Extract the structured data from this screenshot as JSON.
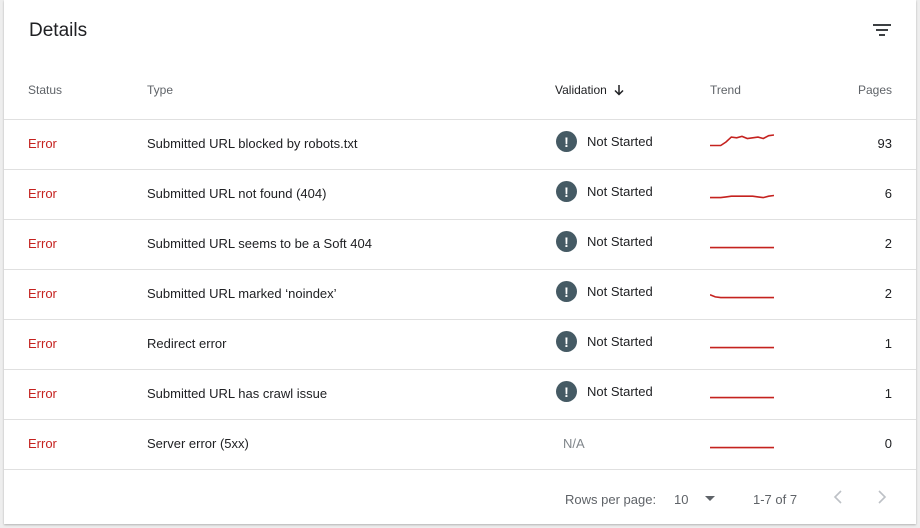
{
  "card": {
    "title": "Details",
    "filter_icon": "filter-list-icon"
  },
  "columns": {
    "status": "Status",
    "type": "Type",
    "validation": "Validation",
    "trend": "Trend",
    "pages": "Pages"
  },
  "rows": [
    {
      "status": "Error",
      "type": "Submitted URL blocked by robots.txt",
      "validation": "Not Started",
      "validation_icon": "!",
      "pages": "93",
      "trend": [
        0.25,
        0.25,
        0.25,
        0.5,
        0.85,
        0.8,
        0.9,
        0.75,
        0.8,
        0.85,
        0.75,
        0.95,
        1.0
      ]
    },
    {
      "status": "Error",
      "type": "Submitted URL not found (404)",
      "validation": "Not Started",
      "validation_icon": "!",
      "pages": "6",
      "trend": [
        0.1,
        0.1,
        0.1,
        0.15,
        0.2,
        0.2,
        0.2,
        0.2,
        0.2,
        0.15,
        0.1,
        0.2,
        0.25
      ]
    },
    {
      "status": "Error",
      "type": "Submitted URL seems to be a Soft 404",
      "validation": "Not Started",
      "validation_icon": "!",
      "pages": "2",
      "trend": [
        0.1,
        0.1,
        0.1,
        0.1,
        0.1,
        0.1,
        0.1,
        0.1,
        0.1,
        0.1,
        0.1,
        0.1,
        0.1
      ]
    },
    {
      "status": "Error",
      "type": "Submitted URL marked ‘noindex’",
      "validation": "Not Started",
      "validation_icon": "!",
      "pages": "2",
      "trend": [
        0.3,
        0.15,
        0.1,
        0.1,
        0.1,
        0.1,
        0.1,
        0.1,
        0.1,
        0.1,
        0.1,
        0.1,
        0.1
      ]
    },
    {
      "status": "Error",
      "type": "Redirect error",
      "validation": "Not Started",
      "validation_icon": "!",
      "pages": "1",
      "trend": [
        0.1,
        0.1,
        0.1,
        0.1,
        0.1,
        0.1,
        0.1,
        0.1,
        0.1,
        0.1,
        0.1,
        0.1,
        0.1
      ]
    },
    {
      "status": "Error",
      "type": "Submitted URL has crawl issue",
      "validation": "Not Started",
      "validation_icon": "!",
      "pages": "1",
      "trend": [
        0.1,
        0.1,
        0.1,
        0.1,
        0.1,
        0.1,
        0.1,
        0.1,
        0.1,
        0.1,
        0.1,
        0.1,
        0.1
      ]
    },
    {
      "status": "Error",
      "type": "Server error (5xx)",
      "validation": "N/A",
      "validation_icon": "",
      "pages": "0",
      "trend": [
        0.1,
        0.1,
        0.1,
        0.1,
        0.1,
        0.1,
        0.1,
        0.1,
        0.1,
        0.1,
        0.1,
        0.1,
        0.1
      ]
    }
  ],
  "footer": {
    "rows_per_page_label": "Rows per page:",
    "rows_per_page_value": "10",
    "range": "1-7 of 7",
    "prev_icon": "chevron-left-icon",
    "next_icon": "chevron-right-icon"
  },
  "colors": {
    "error": "#c5221f",
    "trend": "#c5221f",
    "validation_icon_bg": "#455a64"
  }
}
